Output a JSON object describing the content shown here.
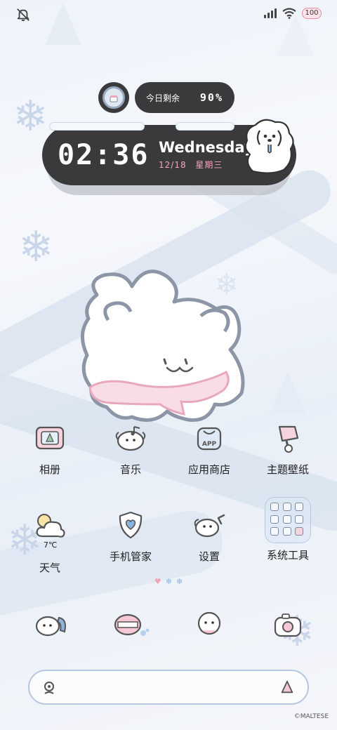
{
  "status_bar": {
    "battery": "100",
    "icons": [
      "silent-icon",
      "signal-icon",
      "wifi-icon",
      "battery-icon"
    ]
  },
  "widget": {
    "remaining_label": "今日剩余",
    "remaining_value": "90%",
    "time": "02:36",
    "weekday_en": "Wednesday",
    "date": "12/18",
    "weekday_cn": "星期三"
  },
  "apps_row1": [
    {
      "label": "相册",
      "icon": "photo-frame-icon"
    },
    {
      "label": "音乐",
      "icon": "music-dog-icon"
    },
    {
      "label": "应用商店",
      "icon": "app-store-icon"
    },
    {
      "label": "主题壁纸",
      "icon": "theme-brush-icon"
    }
  ],
  "apps_row2": [
    {
      "label": "天气",
      "icon": "weather-sun-cloud-icon",
      "temp": "7℃"
    },
    {
      "label": "手机管家",
      "icon": "shield-heart-icon"
    },
    {
      "label": "设置",
      "icon": "settings-dog-icon"
    },
    {
      "label": "系统工具",
      "icon": "folder-icon"
    }
  ],
  "dock": [
    "phone-icon",
    "messages-icon",
    "browser-icon",
    "camera-icon"
  ],
  "search": {
    "left_icon": "search-icon",
    "right_icon": "assistant-icon"
  },
  "copyright": "©MALTESE",
  "colors": {
    "widget_bg": "#3a3a3c",
    "accent_pink": "#f3a6bb",
    "snow_blue": "#b6c7de"
  }
}
